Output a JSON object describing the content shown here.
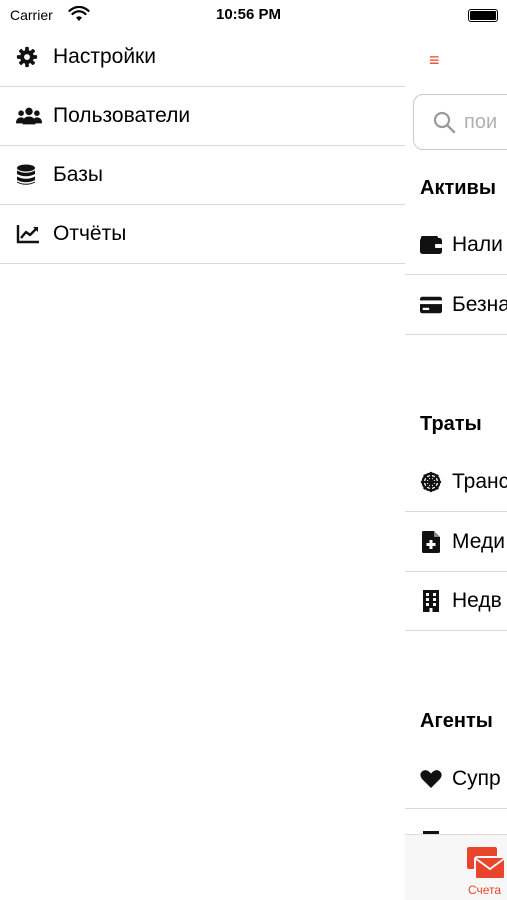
{
  "status_bar": {
    "carrier": "Carrier",
    "time": "10:56 PM"
  },
  "drawer": {
    "items": [
      {
        "label": "Настройки",
        "icon": "gear-icon"
      },
      {
        "label": "Пользователи",
        "icon": "users-icon"
      },
      {
        "label": "Базы",
        "icon": "database-icon"
      },
      {
        "label": "Отчёты",
        "icon": "chart-icon"
      }
    ]
  },
  "main": {
    "menu_glyph": "≡",
    "search": {
      "placeholder": "пои"
    },
    "sections": [
      {
        "title": "Активы",
        "rows": [
          {
            "label": "Нали",
            "icon": "wallet-icon"
          },
          {
            "label": "Безна",
            "icon": "credit-card-icon"
          }
        ]
      },
      {
        "title": "Траты",
        "rows": [
          {
            "label": "Транс",
            "icon": "steering-wheel-icon"
          },
          {
            "label": "Меди",
            "icon": "medical-file-icon"
          },
          {
            "label": "Недв",
            "icon": "building-icon"
          }
        ]
      },
      {
        "title": "Агенты",
        "rows": [
          {
            "label": "Супр",
            "icon": "heart-icon"
          }
        ]
      }
    ],
    "tab_bar": {
      "active_tab_label": "Счета",
      "active_color": "#e8452c"
    }
  }
}
